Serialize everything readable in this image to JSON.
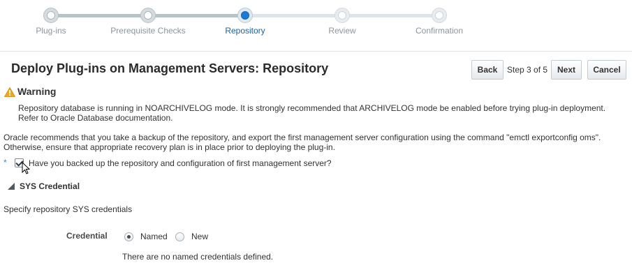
{
  "train": {
    "steps": [
      {
        "label": "Plug-ins",
        "state": "done"
      },
      {
        "label": "Prerequisite Checks",
        "state": "done"
      },
      {
        "label": "Repository",
        "state": "current"
      },
      {
        "label": "Review",
        "state": "pending"
      },
      {
        "label": "Confirmation",
        "state": "pending"
      }
    ]
  },
  "header": {
    "title": "Deploy Plug-ins on Management Servers: Repository",
    "back_label": "Back",
    "step_text": "Step 3 of 5",
    "next_label": "Next",
    "cancel_label": "Cancel"
  },
  "warning": {
    "title": "Warning",
    "line1": "Repository database is running in NOARCHIVELOG mode. It is strongly recommended that ARCHIVELOG mode be enabled before trying plug-in deployment.",
    "line2": "Refer to Oracle Database documentation."
  },
  "recommendation": {
    "line1": "Oracle recommends that you take a backup of the repository, and export the first management server configuration using the command \"emctl exportconfig oms\".",
    "line2": "Otherwise, ensure that appropriate recovery plan is in place prior to deploying the plug-in."
  },
  "backup_check": {
    "required_mark": "*",
    "label": "Have you backed up the repository and configuration of first management server?",
    "checked": true
  },
  "sys_credential": {
    "title": "SYS Credential",
    "description": "Specify repository SYS credentials",
    "credential_label": "Credential",
    "options": [
      "Named",
      "New"
    ],
    "selected": "Named",
    "no_creds_text": "There are no named credentials defined."
  },
  "colors": {
    "accent": "#1b7ad6",
    "warning": "#e8a317"
  },
  "icons": [
    "warning-icon",
    "collapse-triangle-icon",
    "mouse-pointer-icon"
  ]
}
